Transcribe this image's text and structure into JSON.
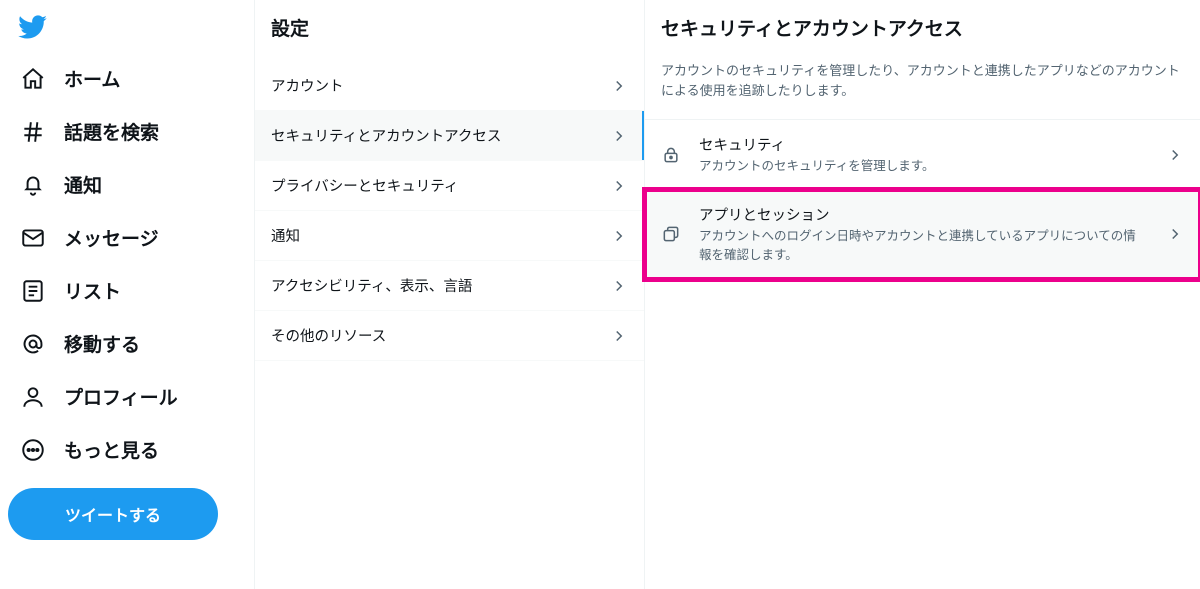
{
  "nav": {
    "items": [
      {
        "label": "ホーム"
      },
      {
        "label": "話題を検索"
      },
      {
        "label": "通知"
      },
      {
        "label": "メッセージ"
      },
      {
        "label": "リスト"
      },
      {
        "label": "移動する"
      },
      {
        "label": "プロフィール"
      },
      {
        "label": "もっと見る"
      }
    ],
    "tweet_button": "ツイートする"
  },
  "settings": {
    "header": "設定",
    "items": [
      {
        "label": "アカウント"
      },
      {
        "label": "セキュリティとアカウントアクセス"
      },
      {
        "label": "プライバシーとセキュリティ"
      },
      {
        "label": "通知"
      },
      {
        "label": "アクセシビリティ、表示、言語"
      },
      {
        "label": "その他のリソース"
      }
    ]
  },
  "panel": {
    "header": "セキュリティとアカウントアクセス",
    "description": "アカウントのセキュリティを管理したり、アカウントと連携したアプリなどのアカウントによる使用を追跡したりします。",
    "rows": [
      {
        "title": "セキュリティ",
        "sub": "アカウントのセキュリティを管理します。"
      },
      {
        "title": "アプリとセッション",
        "sub": "アカウントへのログイン日時やアカウントと連携しているアプリについての情報を確認します。"
      }
    ]
  },
  "colors": {
    "accent": "#1d9bf0",
    "highlight": "#ec008c"
  }
}
